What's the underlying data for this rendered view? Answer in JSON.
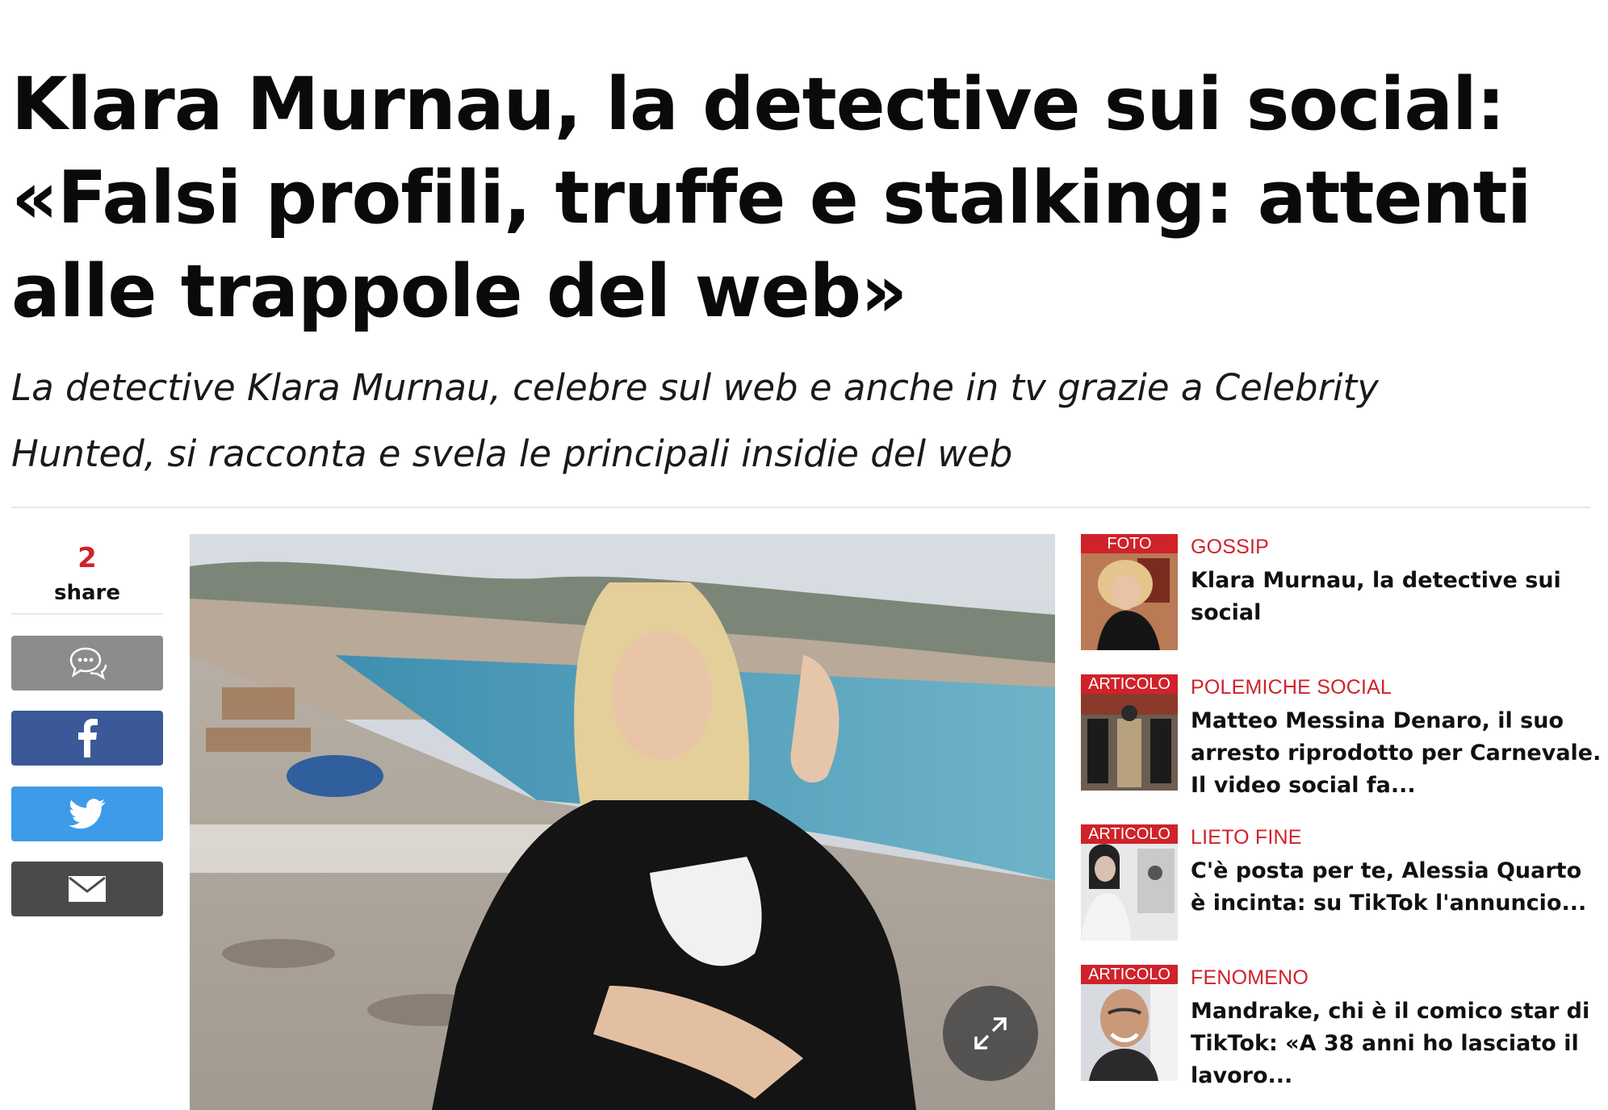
{
  "article": {
    "headline": "Klara Murnau, la detective sui social: «Falsi profili, truffe e stalking: attenti alle trappole del web»",
    "subtitle": "La detective Klara Murnau, celebre sul web e anche in tv grazie a Celebrity Hunted, si racconta e svela le principali insidie del web"
  },
  "share": {
    "count": "2",
    "label": "share",
    "buttons": [
      {
        "name": "comments",
        "icon": "comments-icon"
      },
      {
        "name": "facebook",
        "icon": "facebook-icon"
      },
      {
        "name": "twitter",
        "icon": "twitter-icon"
      },
      {
        "name": "email",
        "icon": "email-icon"
      }
    ]
  },
  "hero": {
    "icon": "expand-icon"
  },
  "sidebar": {
    "items": [
      {
        "tag": "FOTO",
        "category": "GOSSIP",
        "title": "Klara Murnau, la detective sui social"
      },
      {
        "tag": "ARTICOLO",
        "category": "POLEMICHE SOCIAL",
        "title": "Matteo Messina Denaro, il suo arresto riprodotto per Carnevale. Il video social fa..."
      },
      {
        "tag": "ARTICOLO",
        "category": "LIETO FINE",
        "title": "C'è posta per te, Alessia Quarto è incinta: su TikTok l'annuncio..."
      },
      {
        "tag": "ARTICOLO",
        "category": "FENOMENO",
        "title": "Mandrake, chi è il comico star di TikTok: «A 38 anni ho lasciato il lavoro..."
      }
    ]
  },
  "colors": {
    "accent": "#d0222a",
    "facebook": "#3b5998",
    "twitter": "#3d9be9",
    "comments": "#8c8c8c",
    "email": "#4a4a4a"
  }
}
